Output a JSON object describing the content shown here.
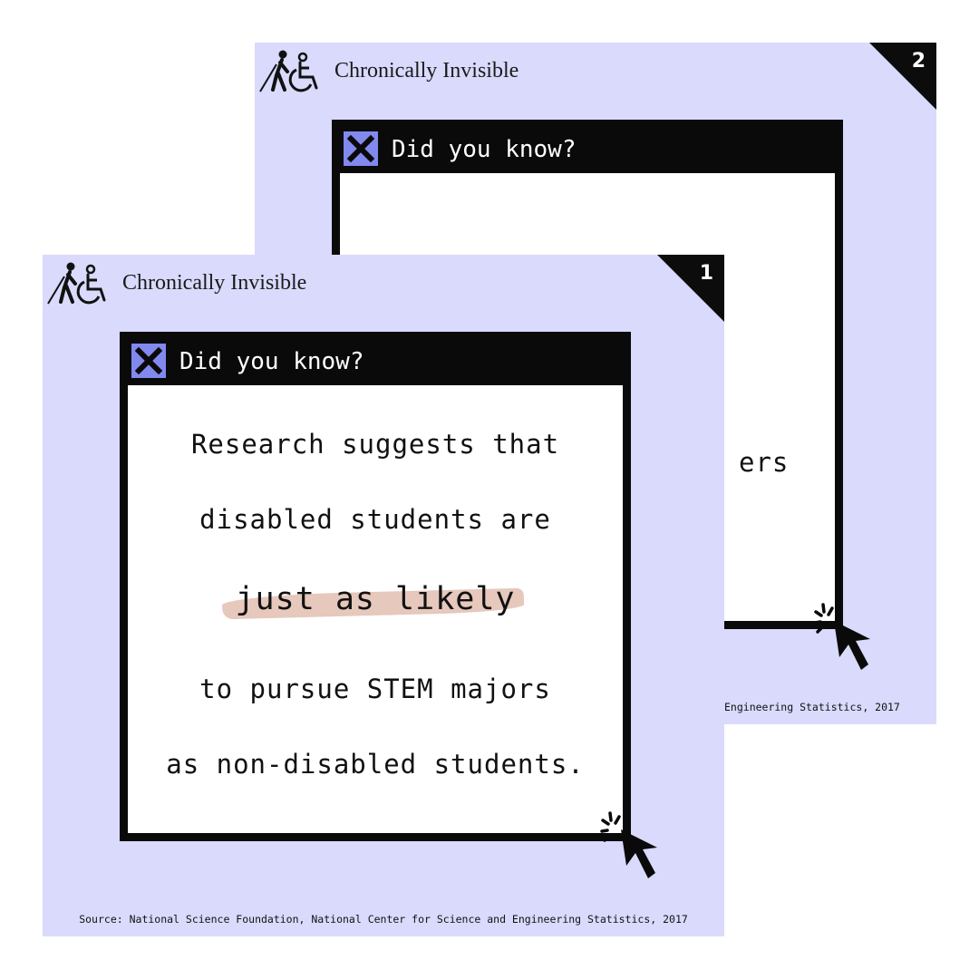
{
  "brand": {
    "name": "Chronically Invisible",
    "icon": "accessibility-figures-icon"
  },
  "card_back": {
    "number": "2",
    "window_title": "Did you know?",
    "visible_text_fragment": "ers",
    "source_fragment": "Engineering Statistics, 2017"
  },
  "card_front": {
    "number": "1",
    "window_title": "Did you know?",
    "lines": [
      "Research suggests that",
      "disabled students are",
      "to pursue STEM majors",
      "as non-disabled students."
    ],
    "highlight": "just as likely",
    "source": "Source: National Science Foundation, National Center for Science and Engineering Statistics, 2017"
  },
  "colors": {
    "card_background": "#d9dafc",
    "close_box": "#8189ef",
    "highlight": "#e6c8bc",
    "frame": "#0a0a0a"
  }
}
